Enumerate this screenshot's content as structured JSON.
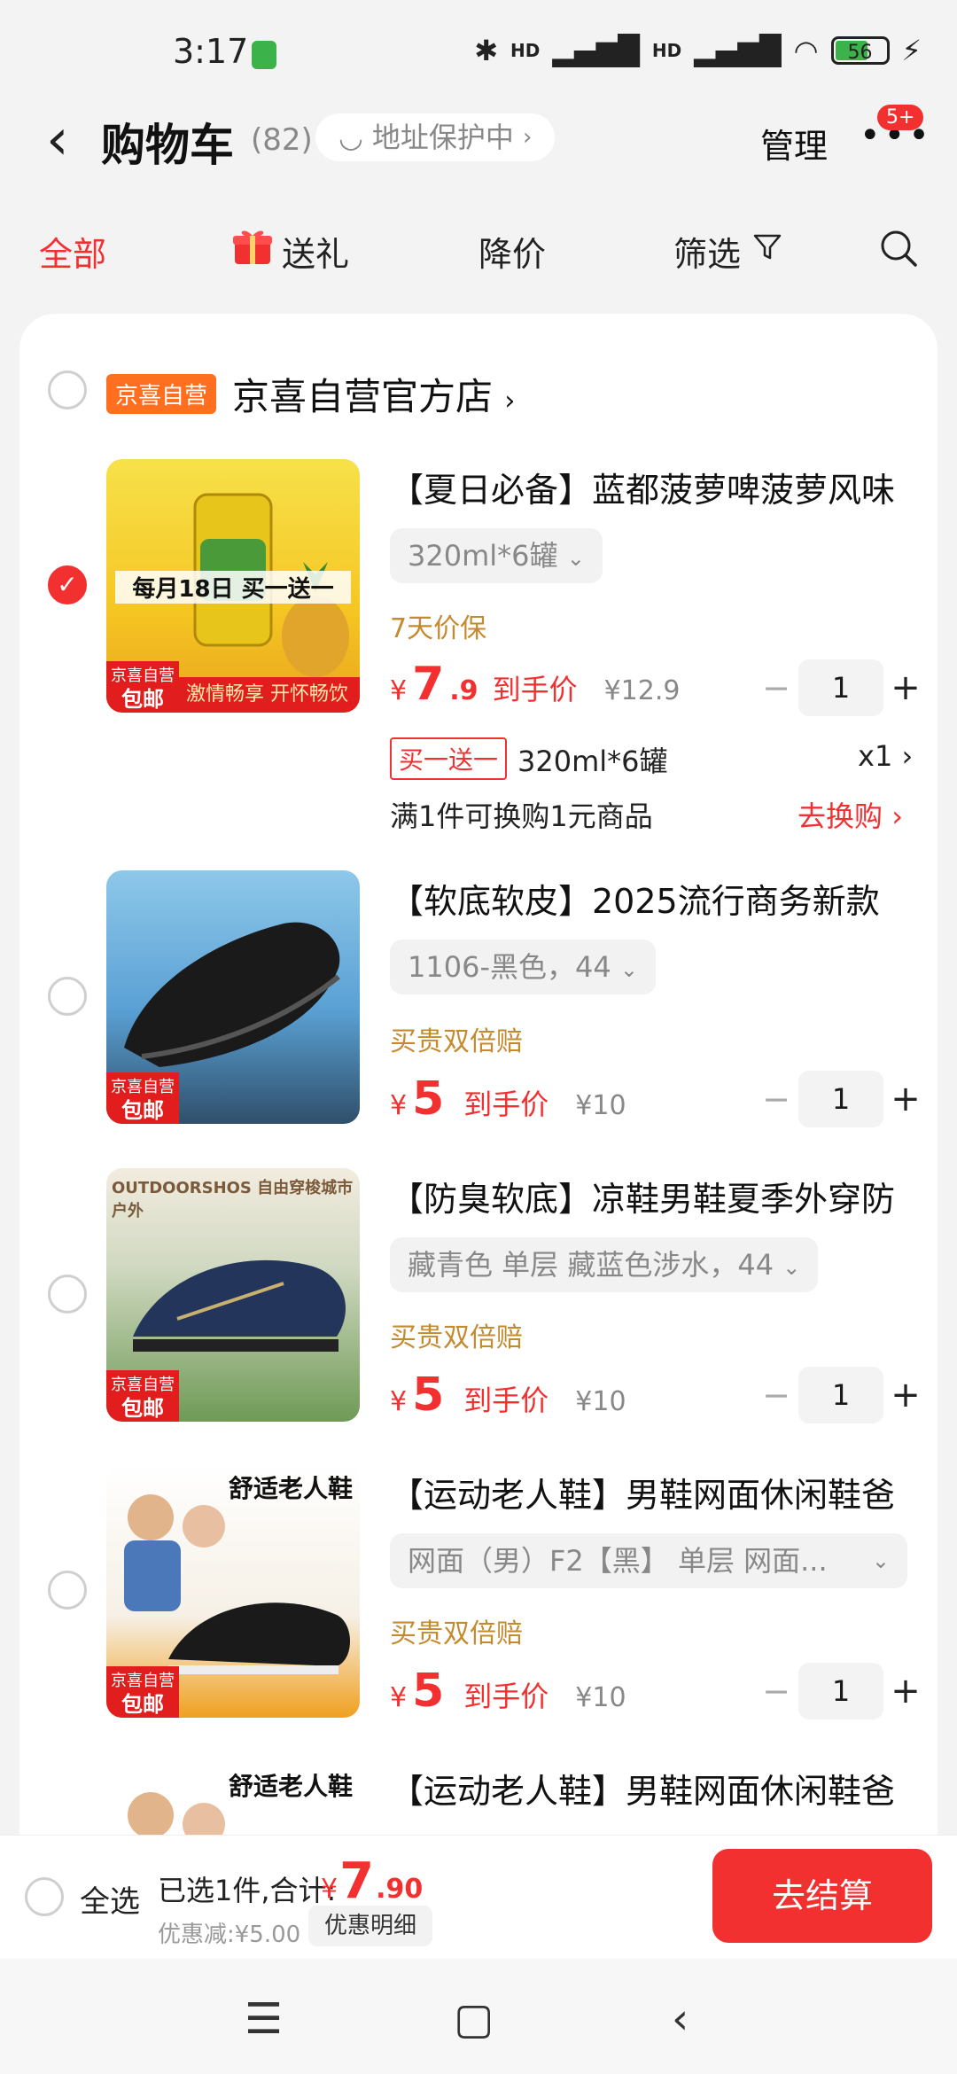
{
  "status_bar": {
    "time": "3:17",
    "network": "HD",
    "battery": "56"
  },
  "header": {
    "title": "购物车",
    "count": "(82)",
    "address_protect": "地址保护中",
    "manage": "管理",
    "badge": "5+"
  },
  "tabs": [
    {
      "label": "全部"
    },
    {
      "label": "送礼"
    },
    {
      "label": "降价"
    },
    {
      "label": "筛选"
    }
  ],
  "store": {
    "tag": "京喜自营",
    "name": "京喜自营官方店"
  },
  "products": [
    {
      "title": "【夏日必备】蓝都菠萝啤菠萝风味",
      "spec": "320ml*6罐",
      "tagline": "7天价保",
      "price_yen": "¥",
      "price_int": "7",
      "price_dec": ".9",
      "price_hand": "到手价",
      "orig_price": "¥12.9",
      "qty": "1",
      "img_label_1": "京喜自营",
      "img_label_2": "包邮",
      "img_banner": "每月18日 买一送一",
      "img_footer": "激情畅享 开怀畅饮",
      "checked": true
    },
    {
      "title": "【软底软皮】2025流行商务新款",
      "spec": "1106-黑色，44",
      "tagline": "买贵双倍赔",
      "price_yen": "¥",
      "price_int": "5",
      "price_dec": "",
      "price_hand": "到手价",
      "orig_price": "¥10",
      "qty": "1",
      "img_label_1": "京喜自营",
      "img_label_2": "包邮",
      "checked": false
    },
    {
      "title": "【防臭软底】凉鞋男鞋夏季外穿防",
      "spec": "藏青色 单层 藏蓝色涉水，44",
      "tagline": "买贵双倍赔",
      "price_yen": "¥",
      "price_int": "5",
      "price_dec": "",
      "price_hand": "到手价",
      "orig_price": "¥10",
      "qty": "1",
      "img_label_1": "京喜自营",
      "img_label_2": "包邮",
      "img_banner": "OUTDOORSHOS 自由穿梭城市户外",
      "checked": false
    },
    {
      "title": "【运动老人鞋】男鞋网面休闲鞋爸",
      "spec": "网面（男）F2【黑】 单层 网面...",
      "tagline": "买贵双倍赔",
      "price_yen": "¥",
      "price_int": "5",
      "price_dec": "",
      "price_hand": "到手价",
      "orig_price": "¥10",
      "qty": "1",
      "img_label_1": "京喜自营",
      "img_label_2": "包邮",
      "img_banner": "舒适老人鞋",
      "checked": false
    },
    {
      "title": "【运动老人鞋】男鞋网面休闲鞋爸",
      "img_banner": "舒适老人鞋"
    }
  ],
  "bogo": {
    "tag": "买一送一",
    "spec": "320ml*6罐",
    "count": "x1"
  },
  "swap": {
    "text": "满1件可换购1元商品",
    "link": "去换购"
  },
  "bottom": {
    "select_all": "全选",
    "selected": "已选1件,合计:",
    "total_yen": "¥",
    "total_int": "7",
    "total_dec": ".90",
    "discount": "优惠减:¥5.00",
    "detail": "优惠明细",
    "checkout": "去结算"
  },
  "colors": {
    "accent": "#f23030",
    "tag_orange": "#ff6f1f",
    "gold": "#c48a2e"
  }
}
